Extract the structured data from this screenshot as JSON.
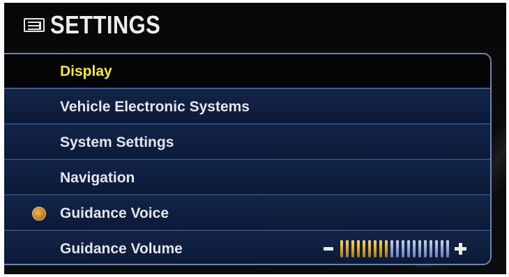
{
  "header": {
    "title": "SETTINGS",
    "icon": "settings-menu-icon"
  },
  "menu": {
    "items": [
      {
        "label": "Display",
        "selected": true
      },
      {
        "label": "Vehicle Electronic Systems",
        "selected": false
      },
      {
        "label": "System Settings",
        "selected": false
      },
      {
        "label": "Navigation",
        "selected": false
      },
      {
        "label": "Guidance Voice",
        "selected": false,
        "indicator": "on"
      },
      {
        "label": "Guidance Volume",
        "selected": false
      }
    ]
  },
  "volume": {
    "level": 9,
    "max": 20
  },
  "colors": {
    "selected_text": "#f2ea33",
    "menu_background": "#0e1d3e",
    "menu_border": "#6e86b4",
    "volume_on": "#d8a42b",
    "volume_off": "#8ea3cf"
  }
}
